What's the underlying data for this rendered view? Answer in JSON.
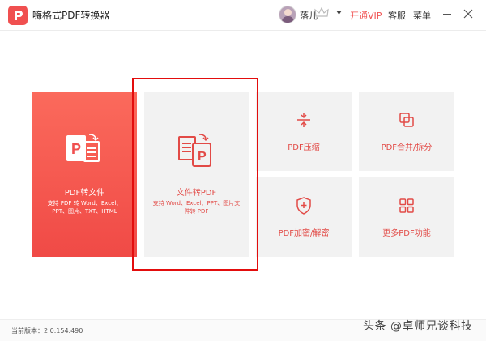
{
  "app": {
    "title": "嗨格式PDF转换器"
  },
  "header": {
    "username": "落儿",
    "vip_label": "开通VIP",
    "service_label": "客服",
    "menu_label": "菜单"
  },
  "tiles": {
    "pdf_to_file": {
      "label": "PDF转文件",
      "desc_line1": "支持 PDF 转 Word、Excel、",
      "desc_line2": "PPT、图片、TXT、HTML"
    },
    "file_to_pdf": {
      "label": "文件转PDF",
      "desc_line1": "支持 Word、Excel、PPT、图片文",
      "desc_line2": "件转 PDF"
    },
    "pdf_compress": {
      "label": "PDF压缩"
    },
    "pdf_merge_split": {
      "label": "PDF合并/拆分"
    },
    "pdf_encrypt": {
      "label": "PDF加密/解密"
    },
    "more": {
      "label": "更多PDF功能"
    }
  },
  "footer": {
    "version": "当前版本：2.0.154.490"
  },
  "watermark": "头条 @卓师兄谈科技",
  "colors": {
    "accent": "#f05050",
    "highlight_border": "#e30d0d",
    "tile_bg": "#f2f2f2"
  },
  "icons": [
    "app-logo-icon",
    "crown-icon",
    "chevron-down-icon",
    "minimize-icon",
    "close-icon",
    "pdf-to-file-icon",
    "file-to-pdf-icon",
    "compress-icon",
    "merge-split-icon",
    "shield-plus-icon",
    "grid-icon"
  ]
}
